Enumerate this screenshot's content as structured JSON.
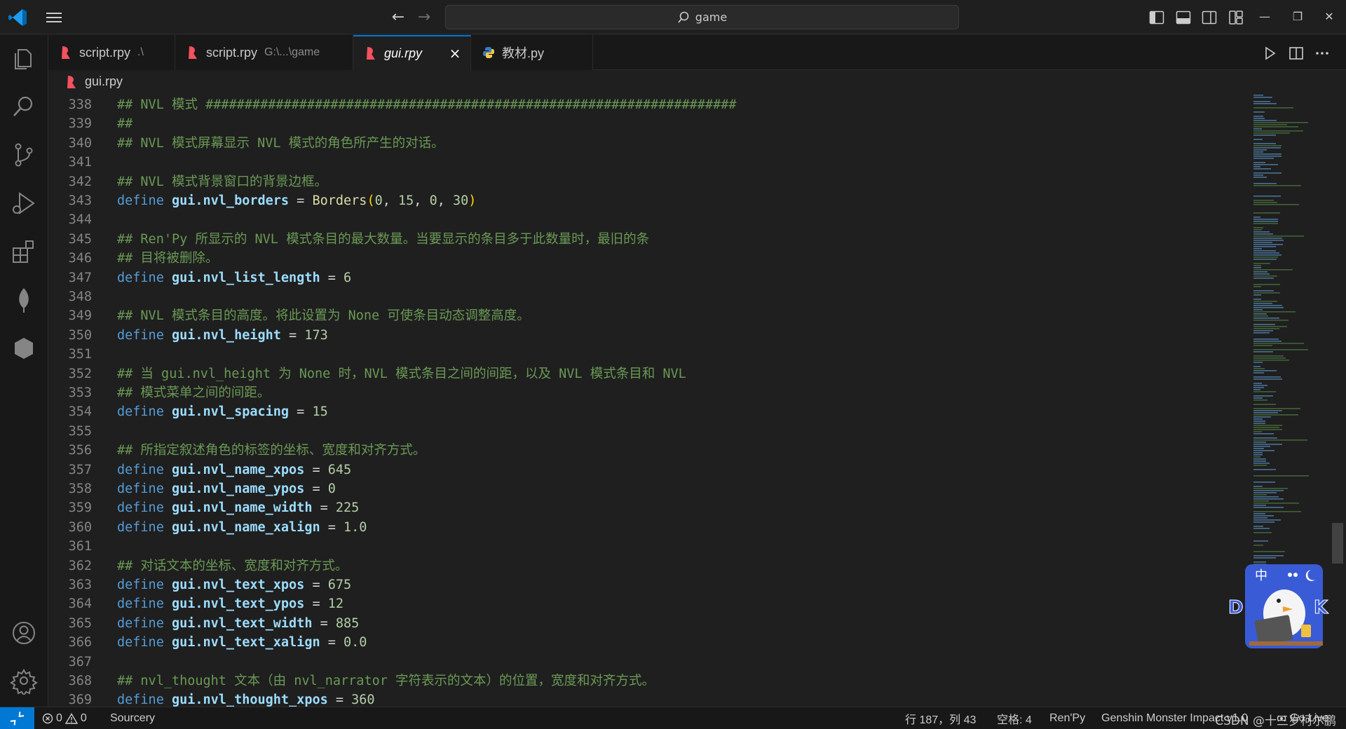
{
  "titlebar": {
    "search_text": "game"
  },
  "tabs": [
    {
      "label": "script.rpy",
      "desc": ".\\",
      "active": false
    },
    {
      "label": "script.rpy",
      "desc": "G:\\...\\game",
      "active": false
    },
    {
      "label": "gui.rpy",
      "desc": "",
      "active": true
    },
    {
      "label": "教材.py",
      "desc": "",
      "active": false
    }
  ],
  "breadcrumb": {
    "file": "gui.rpy"
  },
  "editor": {
    "lines": [
      {
        "n": "338",
        "t": [
          [
            "c-comment",
            "## NVL 模式 ####################################################################"
          ]
        ]
      },
      {
        "n": "339",
        "t": [
          [
            "c-comment",
            "##"
          ]
        ]
      },
      {
        "n": "340",
        "t": [
          [
            "c-comment",
            "## NVL 模式屏幕显示 NVL 模式的角色所产生的对话。"
          ]
        ]
      },
      {
        "n": "341",
        "t": []
      },
      {
        "n": "342",
        "t": [
          [
            "c-comment",
            "## NVL 模式背景窗口的背景边框。"
          ]
        ]
      },
      {
        "n": "343",
        "t": [
          [
            "c-kw",
            "define "
          ],
          [
            "c-var",
            "gui.nvl_borders"
          ],
          [
            "c-op",
            " = "
          ],
          [
            "c-fn",
            "Borders"
          ],
          [
            "c-punc",
            "("
          ],
          [
            "c-num",
            "0"
          ],
          [
            "c-op",
            ", "
          ],
          [
            "c-num",
            "15"
          ],
          [
            "c-op",
            ", "
          ],
          [
            "c-num",
            "0"
          ],
          [
            "c-op",
            ", "
          ],
          [
            "c-num",
            "30"
          ],
          [
            "c-punc",
            ")"
          ]
        ]
      },
      {
        "n": "344",
        "t": []
      },
      {
        "n": "345",
        "t": [
          [
            "c-comment",
            "## Ren'Py 所显示的 NVL 模式条目的最大数量。当要显示的条目多于此数量时，最旧的条"
          ]
        ]
      },
      {
        "n": "346",
        "t": [
          [
            "c-comment",
            "## 目将被删除。"
          ]
        ]
      },
      {
        "n": "347",
        "t": [
          [
            "c-kw",
            "define "
          ],
          [
            "c-var",
            "gui.nvl_list_length"
          ],
          [
            "c-op",
            " = "
          ],
          [
            "c-num",
            "6"
          ]
        ]
      },
      {
        "n": "348",
        "t": []
      },
      {
        "n": "349",
        "t": [
          [
            "c-comment",
            "## NVL 模式条目的高度。将此设置为 None 可使条目动态调整高度。"
          ]
        ]
      },
      {
        "n": "350",
        "t": [
          [
            "c-kw",
            "define "
          ],
          [
            "c-var",
            "gui.nvl_height"
          ],
          [
            "c-op",
            " = "
          ],
          [
            "c-num",
            "173"
          ]
        ]
      },
      {
        "n": "351",
        "t": []
      },
      {
        "n": "352",
        "t": [
          [
            "c-comment",
            "## 当 gui.nvl_height 为 None 时，NVL 模式条目之间的间距，以及 NVL 模式条目和 NVL"
          ]
        ]
      },
      {
        "n": "353",
        "t": [
          [
            "c-comment",
            "## 模式菜单之间的间距。"
          ]
        ]
      },
      {
        "n": "354",
        "t": [
          [
            "c-kw",
            "define "
          ],
          [
            "c-var",
            "gui.nvl_spacing"
          ],
          [
            "c-op",
            " = "
          ],
          [
            "c-num",
            "15"
          ]
        ]
      },
      {
        "n": "355",
        "t": []
      },
      {
        "n": "356",
        "t": [
          [
            "c-comment",
            "## 所指定叙述角色的标签的坐标、宽度和对齐方式。"
          ]
        ]
      },
      {
        "n": "357",
        "t": [
          [
            "c-kw",
            "define "
          ],
          [
            "c-var",
            "gui.nvl_name_xpos"
          ],
          [
            "c-op",
            " = "
          ],
          [
            "c-num",
            "645"
          ]
        ]
      },
      {
        "n": "358",
        "t": [
          [
            "c-kw",
            "define "
          ],
          [
            "c-var",
            "gui.nvl_name_ypos"
          ],
          [
            "c-op",
            " = "
          ],
          [
            "c-num",
            "0"
          ]
        ]
      },
      {
        "n": "359",
        "t": [
          [
            "c-kw",
            "define "
          ],
          [
            "c-var",
            "gui.nvl_name_width"
          ],
          [
            "c-op",
            " = "
          ],
          [
            "c-num",
            "225"
          ]
        ]
      },
      {
        "n": "360",
        "t": [
          [
            "c-kw",
            "define "
          ],
          [
            "c-var",
            "gui.nvl_name_xalign"
          ],
          [
            "c-op",
            " = "
          ],
          [
            "c-num",
            "1.0"
          ]
        ]
      },
      {
        "n": "361",
        "t": []
      },
      {
        "n": "362",
        "t": [
          [
            "c-comment",
            "## 对话文本的坐标、宽度和对齐方式。"
          ]
        ]
      },
      {
        "n": "363",
        "t": [
          [
            "c-kw",
            "define "
          ],
          [
            "c-var",
            "gui.nvl_text_xpos"
          ],
          [
            "c-op",
            " = "
          ],
          [
            "c-num",
            "675"
          ]
        ]
      },
      {
        "n": "364",
        "t": [
          [
            "c-kw",
            "define "
          ],
          [
            "c-var",
            "gui.nvl_text_ypos"
          ],
          [
            "c-op",
            " = "
          ],
          [
            "c-num",
            "12"
          ]
        ]
      },
      {
        "n": "365",
        "t": [
          [
            "c-kw",
            "define "
          ],
          [
            "c-var",
            "gui.nvl_text_width"
          ],
          [
            "c-op",
            " = "
          ],
          [
            "c-num",
            "885"
          ]
        ]
      },
      {
        "n": "366",
        "t": [
          [
            "c-kw",
            "define "
          ],
          [
            "c-var",
            "gui.nvl_text_xalign"
          ],
          [
            "c-op",
            " = "
          ],
          [
            "c-num",
            "0.0"
          ]
        ]
      },
      {
        "n": "367",
        "t": []
      },
      {
        "n": "368",
        "t": [
          [
            "c-comment",
            "## nvl_thought 文本（由 nvl_narrator 字符表示的文本）的位置，宽度和对齐方式。"
          ]
        ]
      },
      {
        "n": "369",
        "t": [
          [
            "c-kw",
            "define "
          ],
          [
            "c-var",
            "gui.nvl_thought_xpos"
          ],
          [
            "c-op",
            " = "
          ],
          [
            "c-num",
            "360"
          ]
        ]
      }
    ]
  },
  "sticker": {
    "glyph_zh": "中"
  },
  "statusbar": {
    "errors": "0",
    "warnings": "0",
    "sourcery": "Sourcery",
    "position": "行 187，列 43",
    "spaces": "空格: 4",
    "language": "Ren'Py",
    "extension": "Genshin Monster Impact v1.0",
    "golive": "Go Live",
    "watermark": "CSDN @十三岁柯尔鹏"
  },
  "colors": {
    "accent": "#0078d4",
    "comment": "#6a9955",
    "keyword": "#569cd6",
    "variable": "#9cdcfe",
    "function": "#dcdcaa",
    "number": "#b5cea8"
  }
}
